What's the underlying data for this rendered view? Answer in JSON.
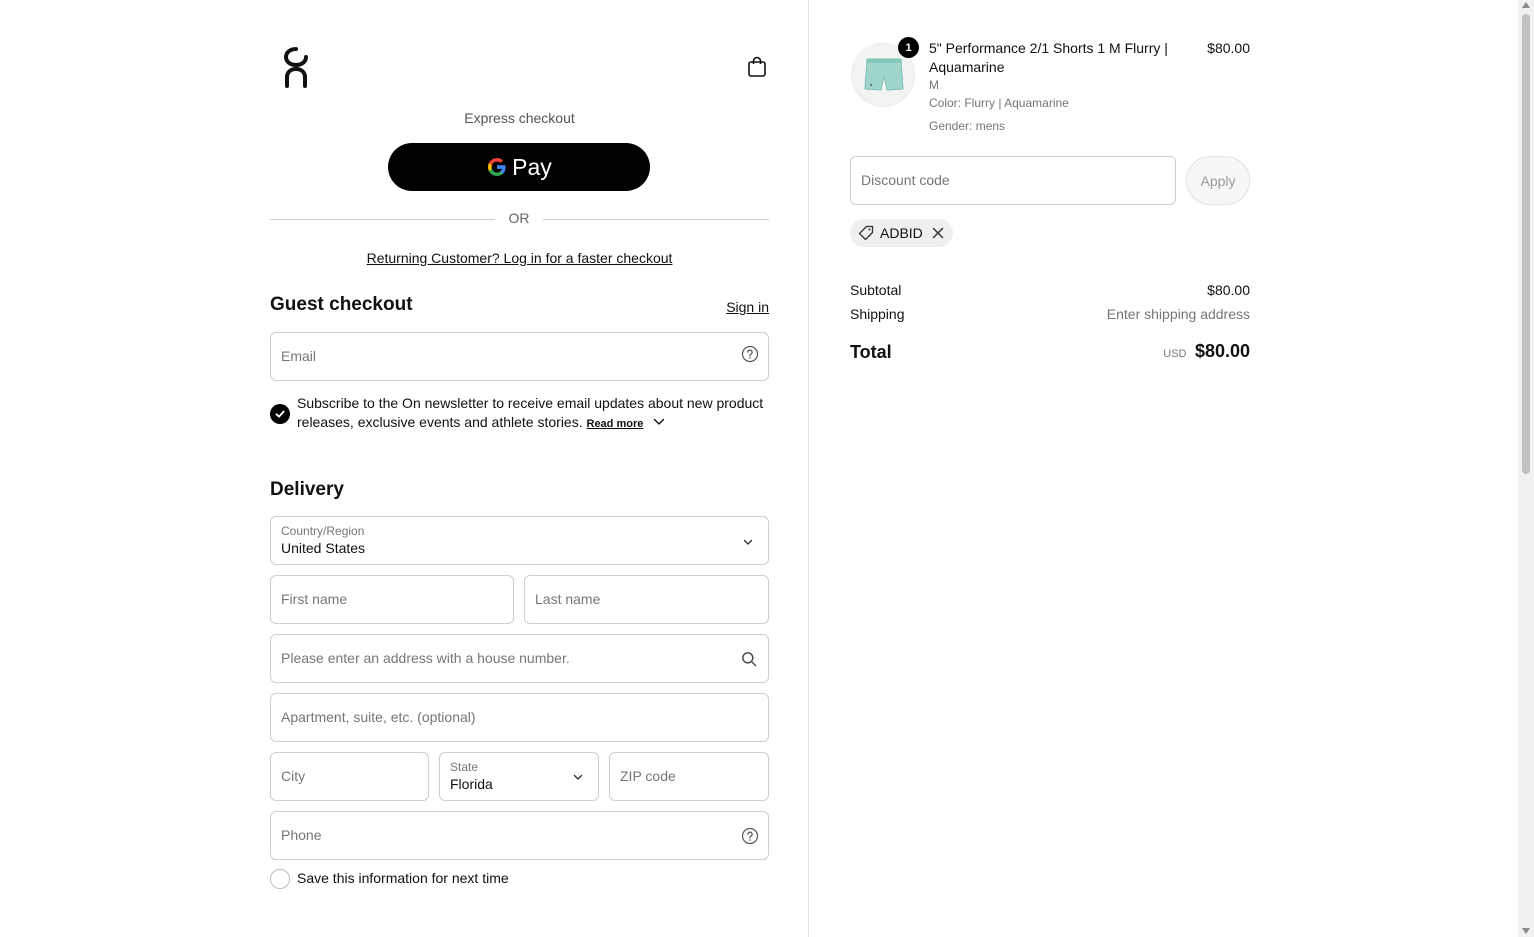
{
  "header": {
    "logo_icon": "on-logo-icon",
    "cart_icon": "shopping-bag-icon"
  },
  "express": {
    "label": "Express checkout",
    "gpay_label": "Pay",
    "or_label": "OR",
    "returning_link": "Returning Customer? Log in for a faster checkout"
  },
  "guest": {
    "title": "Guest checkout",
    "signin": "Sign in",
    "email_placeholder": "Email",
    "newsletter_text": "Subscribe to the On newsletter to receive email updates about new product releases, exclusive events and athlete stories.",
    "newsletter_checked": true,
    "read_more": "Read more"
  },
  "delivery": {
    "title": "Delivery",
    "country_label": "Country/Region",
    "country_value": "United States",
    "first_name_placeholder": "First name",
    "last_name_placeholder": "Last name",
    "address_placeholder": "Please enter an address with a house number.",
    "apartment_placeholder": "Apartment, suite, etc. (optional)",
    "city_placeholder": "City",
    "state_label": "State",
    "state_value": "Florida",
    "zip_placeholder": "ZIP code",
    "phone_placeholder": "Phone",
    "save_label": "Save this information for next time",
    "save_checked": false
  },
  "cart": {
    "item": {
      "quantity": "1",
      "name": "5\" Performance 2/1 Shorts 1 M Flurry | Aquamarine",
      "price": "$80.00",
      "size": "M",
      "color": "Color: Flurry | Aquamarine",
      "gender": "Gender: mens"
    },
    "discount_placeholder": "Discount code",
    "apply_label": "Apply",
    "applied_code": "ADBID",
    "subtotal_label": "Subtotal",
    "subtotal_value": "$80.00",
    "shipping_label": "Shipping",
    "shipping_value": "Enter shipping address",
    "total_label": "Total",
    "total_currency": "USD",
    "total_value": "$80.00"
  },
  "colors": {
    "primary": "#000000",
    "border": "#cfcfcf",
    "muted": "#767676",
    "product_teal": "#9ed6cc"
  }
}
